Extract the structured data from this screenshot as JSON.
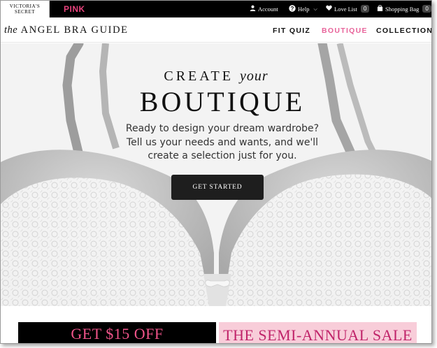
{
  "top_bar": {
    "logo_line1": "VICTORIA'S",
    "logo_line2": "SECRET",
    "pink_label": "PINK",
    "account_label": "Account",
    "help_label": "Help",
    "love_list_label": "Love List",
    "love_list_count": "0",
    "shopping_bag_label": "Shopping Bag",
    "shopping_bag_count": "0"
  },
  "sub_nav": {
    "title_prefix": "the",
    "title_main": "ANGEL BRA GUIDE",
    "links": [
      "FIT QUIZ",
      "BOUTIQUE",
      "COLLECTIONS"
    ],
    "active_link": "BOUTIQUE"
  },
  "hero": {
    "heading_part1": "CREATE",
    "heading_part2": "your",
    "heading_main": "BOUTIQUE",
    "text_line1": "Ready to design your dream wardrobe?",
    "text_line2": "Tell us your needs and wants, and we'll",
    "text_line3": "create a selection just for you.",
    "cta_label": "GET STARTED"
  },
  "promos": {
    "left_text": "GET $15 OFF",
    "right_text": "THE SEMI-ANNUAL SALE"
  },
  "colors": {
    "pink_brand": "#e8427c",
    "nav_active": "#e8639a",
    "cta_bg": "#1e1e1e",
    "sale_bg": "#f8cdd9"
  }
}
